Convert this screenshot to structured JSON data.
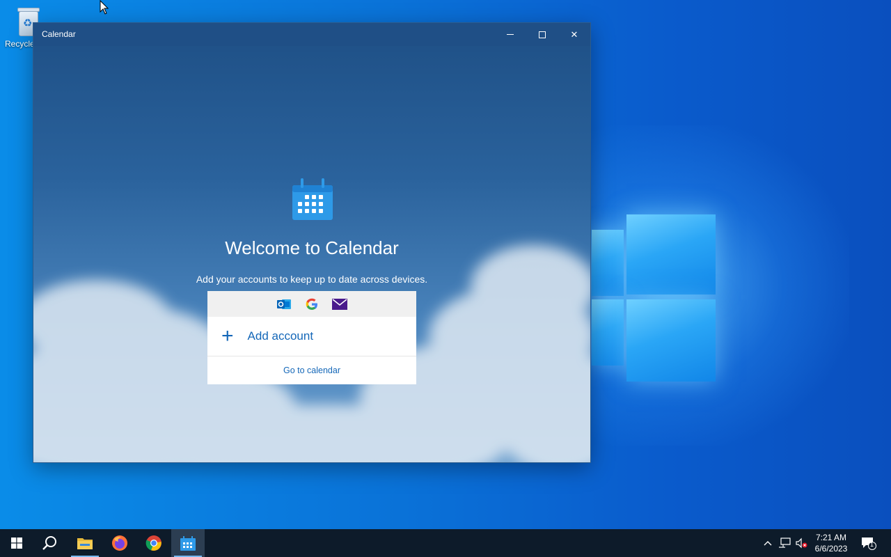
{
  "desktop": {
    "recycle_bin_label": "Recycle"
  },
  "window": {
    "title": "Calendar",
    "minimize_icon": "minimize-icon",
    "maximize_icon": "maximize-icon",
    "close_icon": "close-icon",
    "close_glyph": "✕"
  },
  "welcome": {
    "heading": "Welcome to Calendar",
    "subtitle": "Add your accounts to keep up to date across devices.",
    "providers": [
      "outlook-icon",
      "google-icon",
      "mail-icon"
    ],
    "add_account_label": "Add account",
    "add_icon": "+",
    "goto_calendar_label": "Go to calendar"
  },
  "taskbar": {
    "items": [
      "start-icon",
      "search-icon",
      "file-explorer-icon",
      "firefox-icon",
      "chrome-icon",
      "calendar-icon"
    ],
    "active_item": "calendar-icon",
    "tray": {
      "chevron_glyph": "^",
      "time": "7:21 AM",
      "date": "6/6/2023",
      "notification_count": "1"
    }
  },
  "colors": {
    "accent": "#1467b8",
    "titlebar": "#1f4f86",
    "taskbar": "#0d1b2a"
  }
}
